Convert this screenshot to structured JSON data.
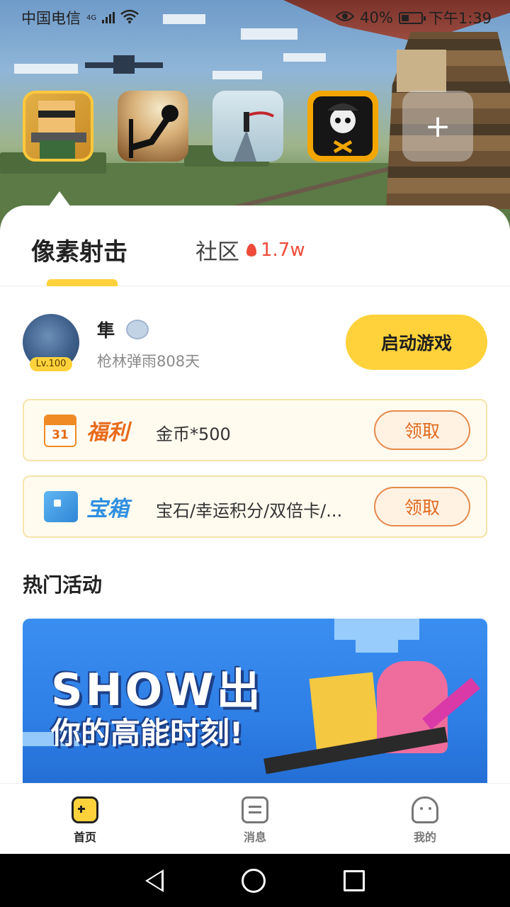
{
  "status_bar": {
    "carrier": "中国电信",
    "network": "4G",
    "battery": "40%",
    "time": "下午1:39"
  },
  "games": [
    {
      "name": "pixel-shooter-icon",
      "active": true
    },
    {
      "name": "stickman-icon",
      "active": false
    },
    {
      "name": "ninja-icon",
      "active": false
    },
    {
      "name": "skull-agent-icon",
      "active": false
    }
  ],
  "add_game_symbol": "+",
  "tabs": {
    "main": "像素射击",
    "community": "社区",
    "community_hot": "1.7w"
  },
  "profile": {
    "name": "隼",
    "level": "Lv.100",
    "subtitle": "枪林弹雨808天",
    "launch_label": "启动游戏"
  },
  "rewards": [
    {
      "tag": "福利",
      "calendar_day": "31",
      "text": "金币*500",
      "button": "领取"
    },
    {
      "tag": "宝箱",
      "text": "宝石/幸运积分/双倍卡/...",
      "button": "领取"
    }
  ],
  "hot_section": {
    "title": "热门活动",
    "banner_title": "SHOW出",
    "banner_subtitle": "你的高能时刻!"
  },
  "bottom_nav": [
    {
      "label": "首页",
      "active": true
    },
    {
      "label": "消息",
      "active": false
    },
    {
      "label": "我的",
      "active": false
    }
  ],
  "colors": {
    "accent": "#ffd23b",
    "reward_orange": "#e86a1c",
    "chest_blue": "#2f8fe0",
    "hot_red": "#ee4b3a"
  }
}
